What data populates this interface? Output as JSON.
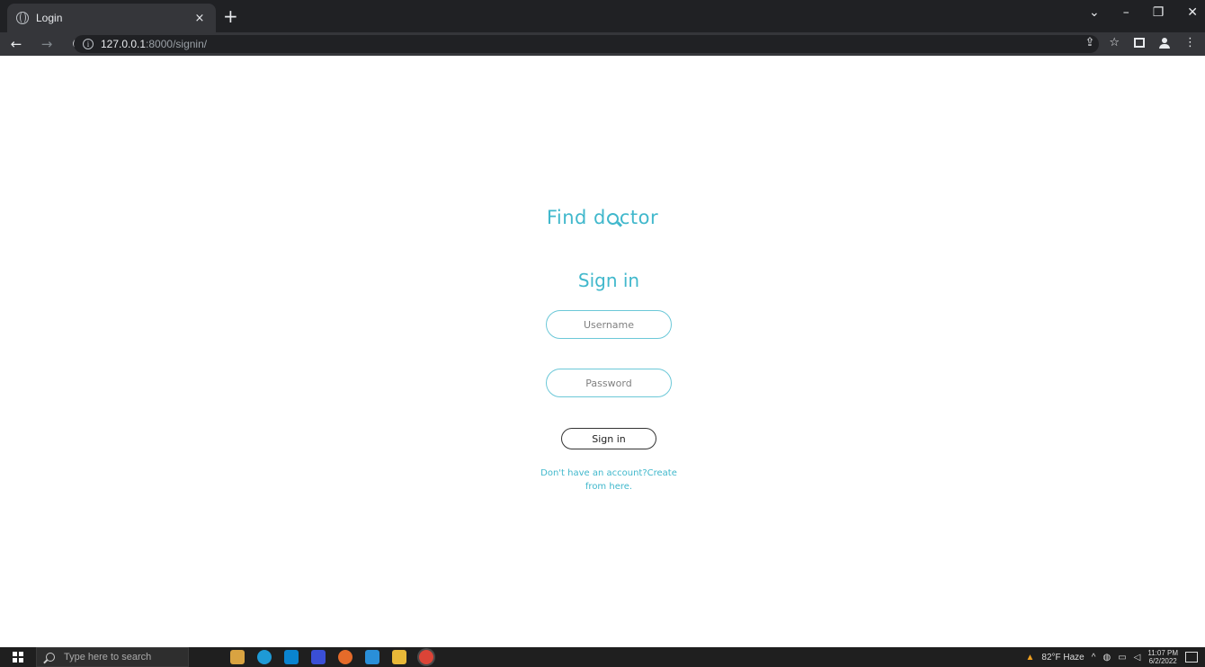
{
  "browser": {
    "tab_title": "Login",
    "tab_close": "×",
    "new_tab": "+",
    "url_host": "127.0.0.1",
    "url_rest": ":8000/signin/",
    "window_controls": [
      "⌄",
      "–",
      "❐",
      "✕"
    ],
    "nav": {
      "back": "←",
      "forward": "→",
      "reload": "C"
    }
  },
  "page": {
    "brand_prefix": "Find d",
    "brand_suffix": "ctor",
    "heading": "Sign in",
    "username_placeholder": "Username",
    "password_placeholder": "Password",
    "signin_button": "Sign in",
    "signup_link": "Don't have an account?Create from here."
  },
  "taskbar": {
    "search_placeholder": "Type here to search",
    "weather": "82°F Haze",
    "time": "11:07 PM",
    "date": "6/2/2022"
  },
  "colors": {
    "accent": "#41b8cc",
    "chrome_dark": "#202124",
    "chrome_mid": "#35363a"
  }
}
